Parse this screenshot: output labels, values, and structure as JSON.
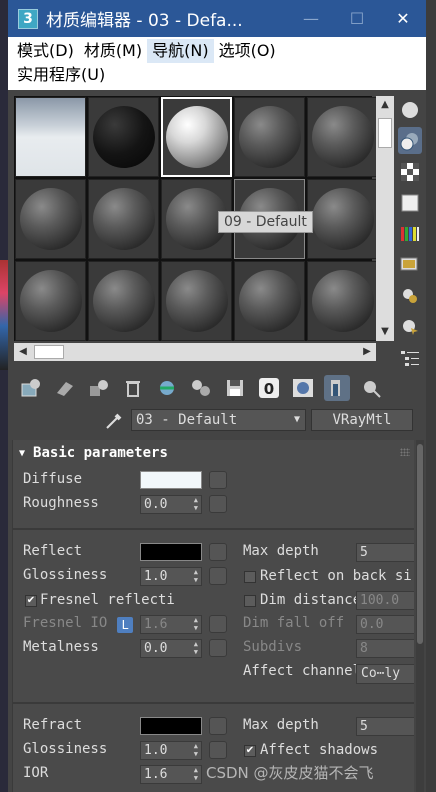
{
  "window": {
    "title": "材质编辑器 - 03 - Defa...",
    "app_icon": "3",
    "minimize": "—",
    "maximize": "☐",
    "close": "✕"
  },
  "menus": {
    "row1": [
      "模式(D)",
      "材质(M)",
      "导航(N)",
      "选项(O)"
    ],
    "row2": [
      "实用程序(U)"
    ]
  },
  "sample_slots": {
    "tooltip": "09 - Default"
  },
  "material": {
    "name": "03 - Default",
    "type": "VRayMtl"
  },
  "rollout": {
    "title": "Basic parameters"
  },
  "diffuse": {
    "diffuse_label": "Diffuse",
    "diffuse_color": "#f2f8fb",
    "roughness_label": "Roughness",
    "roughness_value": "0.0"
  },
  "reflection": {
    "reflect_label": "Reflect",
    "reflect_color": "#000000",
    "glossiness_label": "Glossiness",
    "glossiness_value": "1.0",
    "fresnel_label": "Fresnel reflecti",
    "fresnel_ior_label": "Fresnel IO",
    "fresnel_ior_lock": "L",
    "fresnel_ior_value": "1.6",
    "metalness_label": "Metalness",
    "metalness_value": "0.0",
    "max_depth_label": "Max depth",
    "max_depth_value": "5",
    "reflect_on_back_label": "Reflect on back si",
    "dim_distance_label": "Dim distance",
    "dim_distance_value": "100.0",
    "dim_falloff_label": "Dim fall off",
    "dim_falloff_value": "0.0",
    "subdivs_label": "Subdivs",
    "subdivs_value": "8",
    "affect_channels_label": "Affect channel",
    "affect_channels_value": "Co⋯ly"
  },
  "refraction": {
    "refract_label": "Refract",
    "refract_color": "#000000",
    "glossiness_label": "Glossiness",
    "glossiness_value": "1.0",
    "ior_label": "IOR",
    "ior_value": "1.6",
    "max_depth_label": "Max depth",
    "max_depth_value": "5",
    "affect_shadows_label": "Affect shadows"
  },
  "watermark": "CSDN @灰皮皮猫不会飞",
  "toolbar_zero": "0"
}
